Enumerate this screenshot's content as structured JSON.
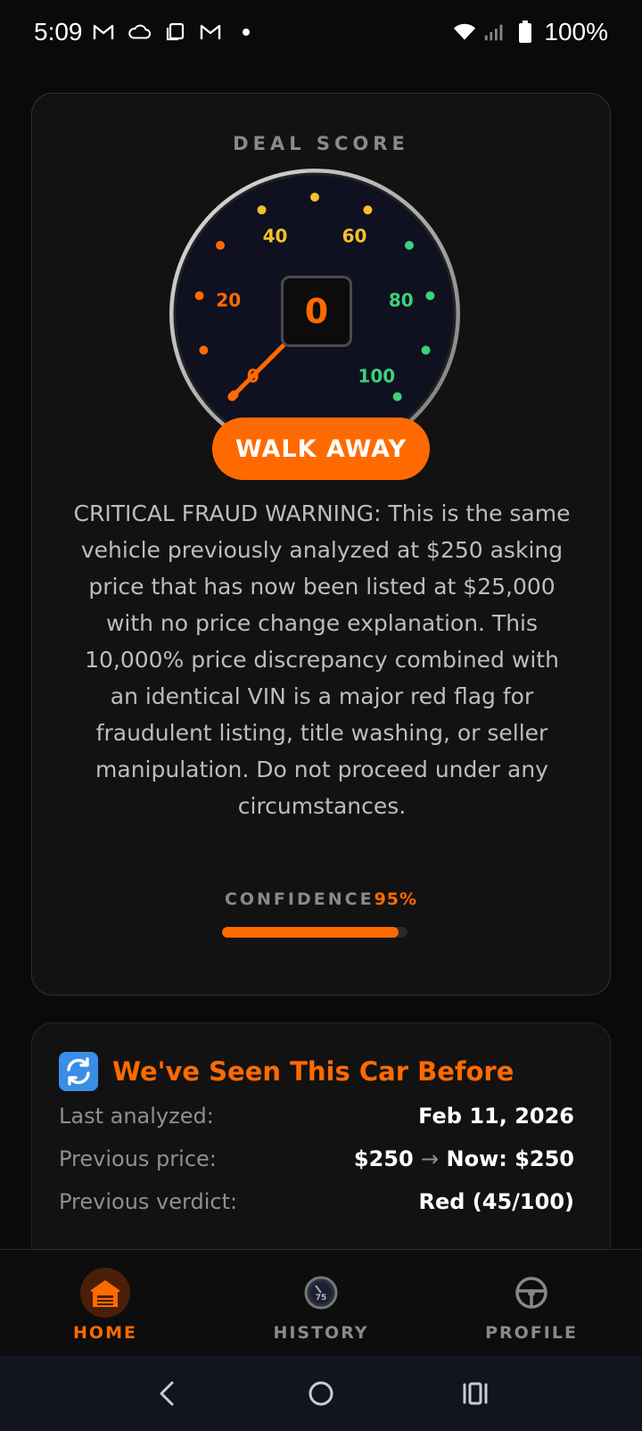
{
  "status_bar": {
    "time": "5:09",
    "battery": "100%"
  },
  "deal_score": {
    "title": "DEAL SCORE",
    "score": "0",
    "tick_labels": [
      "0",
      "20",
      "40",
      "60",
      "80",
      "100"
    ],
    "verdict": "WALK AWAY",
    "description": "CRITICAL FRAUD WARNING: This is the same vehicle previously analyzed at $250 asking price that has now been listed at $25,000 with no price change explanation. This 10,000% price discrepancy combined with an identical VIN is a major red flag for fraudulent listing, title washing, or seller manipulation. Do not proceed under any circumstances.",
    "confidence_label": "CONFIDENCE",
    "confidence_value": "95%",
    "confidence_fraction": 0.95,
    "colors": {
      "accent": "#ff6a00",
      "yellow": "#f5c02a",
      "green": "#3ed07a"
    }
  },
  "seen_card": {
    "title": "We've Seen This Car Before",
    "rows": [
      {
        "label": "Last analyzed:",
        "value": "Feb 11, 2026"
      },
      {
        "label": "Previous price:",
        "value_before": "$250",
        "arrow": "→",
        "value_after": "Now: $250"
      },
      {
        "label": "Previous verdict:",
        "value": "Red (45/100)"
      }
    ]
  },
  "bottom_nav": [
    {
      "label": "HOME",
      "icon": "garage-icon",
      "active": true
    },
    {
      "label": "HISTORY",
      "icon": "speedometer-icon",
      "active": false
    },
    {
      "label": "PROFILE",
      "icon": "steering-wheel-icon",
      "active": false
    }
  ]
}
